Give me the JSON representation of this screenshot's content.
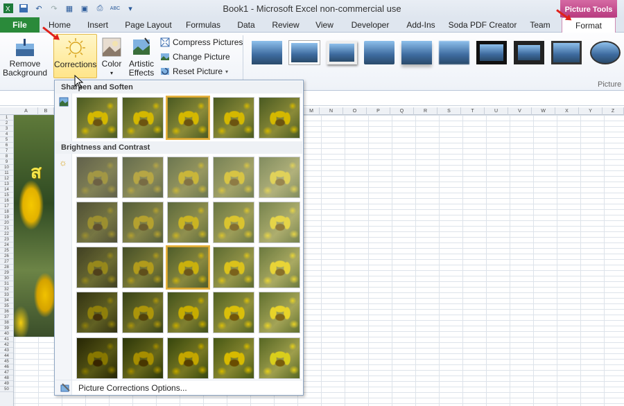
{
  "title": {
    "window": "Book1  -  Microsoft Excel non-commercial use",
    "context": "Picture Tools"
  },
  "tabs": [
    "File",
    "Home",
    "Insert",
    "Page Layout",
    "Formulas",
    "Data",
    "Review",
    "View",
    "Developer",
    "Add-Ins",
    "Soda PDF Creator",
    "Team",
    "Format"
  ],
  "ribbon": {
    "remove_bg": [
      "Remove",
      "Background"
    ],
    "corrections": "Corrections",
    "color": "Color",
    "artistic": [
      "Artistic",
      "Effects"
    ],
    "compress": "Compress Pictures",
    "change": "Change Picture",
    "reset": "Reset Picture",
    "styles_group": "Picture"
  },
  "columns": [
    "A",
    "B",
    "M",
    "N",
    "O",
    "P",
    "Q",
    "R",
    "S",
    "T",
    "U",
    "V",
    "W",
    "X",
    "Y",
    "Z"
  ],
  "rows": [
    "1",
    "2",
    "3",
    "4",
    "5",
    "6",
    "7",
    "8",
    "9",
    "10",
    "11",
    "12",
    "13",
    "14",
    "15",
    "16",
    "17",
    "18",
    "19",
    "20",
    "21",
    "22",
    "23",
    "24",
    "25",
    "26",
    "27",
    "28",
    "29",
    "30",
    "31",
    "32",
    "33",
    "34",
    "35",
    "36",
    "37",
    "38",
    "39",
    "40",
    "41",
    "42",
    "43",
    "44",
    "45",
    "46",
    "47",
    "48",
    "49",
    "50"
  ],
  "menu": {
    "sharpen_title": "Sharpen and Soften",
    "brightness_title": "Brightness and Contrast",
    "options": "Picture Corrections Options..."
  },
  "sheet_text": "ส",
  "colors": {
    "accent_file": "#2a8a3a",
    "context_tab": "#b83b80",
    "highlight": "#e6b340"
  }
}
